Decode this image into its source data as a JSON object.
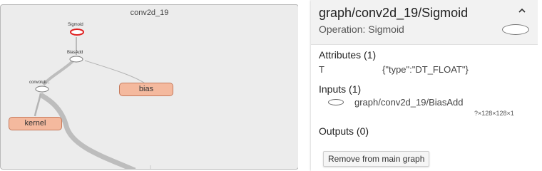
{
  "graph": {
    "group_title": "conv2d_19",
    "nodes": {
      "sigmoid": "Sigmoid",
      "biasadd": "BiasAdd",
      "convolution": "convoluti...",
      "bias": "bias",
      "kernel": "kernel"
    }
  },
  "info": {
    "title": "graph/conv2d_19/Sigmoid",
    "operation": "Operation: Sigmoid",
    "attributes_title": "Attributes (1)",
    "attributes": [
      {
        "key": "T",
        "value": "{\"type\":\"DT_FLOAT\"}"
      }
    ],
    "inputs_title": "Inputs (1)",
    "inputs": [
      {
        "name": "graph/conv2d_19/BiasAdd",
        "shape": "?×128×128×1"
      }
    ],
    "outputs_title": "Outputs (0)",
    "remove_button": "Remove from main graph"
  },
  "colors": {
    "selected_outline": "#e02020",
    "const_fill": "#f4b99e",
    "edge": "#b4b4b4"
  },
  "icons": {
    "collapse": "chevron-up-icon",
    "node_shape": "ellipse-icon"
  }
}
